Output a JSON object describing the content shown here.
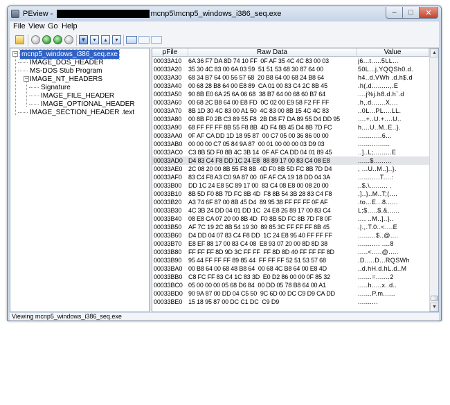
{
  "window": {
    "title_prefix": "PEview - ",
    "title_suffix": "mcnp5\\mcnp5_windows_i386_seq.exe",
    "minimize_glyph": "–",
    "maximize_glyph": "□",
    "close_glyph": "✕"
  },
  "menu": {
    "file": "File",
    "view": "View",
    "go": "Go",
    "help": "Help"
  },
  "toolbar_icons": [
    "open-folder-icon",
    "back-icon",
    "forward-icon",
    "up-icon",
    "down-icon",
    "save-icon",
    "byte-view-icon",
    "word-view-icon",
    "dword-view-icon",
    "address-icon",
    "column-view-icon",
    "row-view-icon"
  ],
  "tree": {
    "root": "mcnp5_windows_i386_seq.exe",
    "items": [
      "IMAGE_DOS_HEADER",
      "MS-DOS Stub Program",
      "IMAGE_NT_HEADERS",
      "Signature",
      "IMAGE_FILE_HEADER",
      "IMAGE_OPTIONAL_HEADER",
      "IMAGE_SECTION_HEADER .text"
    ]
  },
  "grid": {
    "headers": {
      "addr": "pFile",
      "raw": "Raw Data",
      "value": "Value"
    },
    "rows": [
      {
        "addr": "00033A10",
        "raw": "6A 36 F7 DA 8D 74 10 FF  0F AF 35 4C 4C 83 00 03",
        "value": "j6...t.....5LL..."
      },
      {
        "addr": "00033A20",
        "raw": "35 30 4C 83 00 6A 03 59  51 51 53 68 30 87 64 00",
        "value": "50L...j.YQQSh0.d."
      },
      {
        "addr": "00033A30",
        "raw": "68 34 B7 64 00 56 57 68  20 B8 64 00 68 24 B8 64",
        "value": "h4..d.VWh .d.h$.d"
      },
      {
        "addr": "00033A40",
        "raw": "00 68 28 B8 64 00 E8 89  CA 01 00 83 C4 2C 8B 45",
        "value": ".h(.d.........,.E"
      },
      {
        "addr": "00033A50",
        "raw": "90 8B E0 6A 25 6A 06 68  38 B7 64 00 68 60 B7 64",
        "value": "....j%j.h8.d.h`.d"
      },
      {
        "addr": "00033A60",
        "raw": "00 68 2C B8 64 00 E8 FD  0C 02 00 E9 58 F2 FF FF",
        "value": ".h,.d.......X...."
      },
      {
        "addr": "00033A70",
        "raw": "8B 1D 30 4C 83 00 A1 50  4C 83 00 8B 15 4C 4C 83",
        "value": "..0L...PL....LL."
      },
      {
        "addr": "00033A80",
        "raw": "00 8B F0 2B C3 89 55 F8  2B D8 F7 DA 89 55 D4 DD 95",
        "value": "....+..U.+....U.."
      },
      {
        "addr": "00033A90",
        "raw": "68 FF FF FF 8B 55 F8 8B  4D F4 8B 45 D4 8B 7D FC",
        "value": "h....U..M..E..}."
      },
      {
        "addr": "00033AA0",
        "raw": "0F AF CA DD 1D 18 95 87  00 C7 05 00 36 86 00 00",
        "value": "............6..."
      },
      {
        "addr": "00033AB0",
        "raw": "00 00 00 C7 05 84 9A 87  00 01 00 00 00 03 D9 03",
        "value": "................"
      },
      {
        "addr": "00033AC0",
        "raw": "C3 8B 5D F0 8B 4C 3B 14  0F AF CA DD 04 01 89 45",
        "value": "..]..L;.........E"
      },
      {
        "addr": "00033AD0",
        "raw": "D4 83 C4 F8 DD 1C 24 E8  88 89 17 00 83 C4 08 E8",
        "value": "......$........."
      },
      {
        "addr": "00033AE0",
        "raw": "2C 08 20 00 8B 55 F8 8B  4D F0 8B 5D FC 8B 7D D4",
        "value": ", ...U..M..]..}."
      },
      {
        "addr": "00033AF0",
        "raw": "83 C4 F8 A3 C0 9A 87 00  0F AF CA 19 18 DD 04 3A",
        "value": "...........T....:"
      },
      {
        "addr": "00033B00",
        "raw": "DD 1C 24 E8 5C 89 17 00  83 C4 08 E8 00 08 20 00",
        "value": "..$.\\......... ."
      },
      {
        "addr": "00033B10",
        "raw": "8B 5D F0 8B 7D FC 8B 4D  F8 8B 54 3B 28 83 C4 F8",
        "value": ".]..}..M..T;(...."
      },
      {
        "addr": "00033B20",
        "raw": "A3 74 6F 87 00 8B 45 D4  89 95 38 FF FF FF 0F AF",
        "value": ".to...E...8......"
      },
      {
        "addr": "00033B30",
        "raw": "4C 3B 24 DD 04 01 DD 1C  24 E8 26 89 17 00 83 C4",
        "value": "L;$.....$.&......"
      },
      {
        "addr": "00033B40",
        "raw": "08 E8 CA 07 20 00 8B 4D  F0 8B 5D FC 8B 7D F8 0F",
        "value": ".... ..M..]..}.."
      },
      {
        "addr": "00033B50",
        "raw": "AF 7C 19 2C 8B 54 19 30  89 85 3C FF FF FF 8B 45",
        "value": ".|.,.T.0..<....E"
      },
      {
        "addr": "00033B60",
        "raw": "D4 DD 04 07 83 C4 F8 DD  1C 24 E8 95 40 FF FF FF",
        "value": ".........$..@...."
      },
      {
        "addr": "00033B70",
        "raw": "E8 EF 88 17 00 83 C4 08  E8 93 07 20 00 8D 8D 38",
        "value": "........... ....8"
      },
      {
        "addr": "00033B80",
        "raw": "FF FF FF 8D 9D 3C FF FF  FF 8D 8D 40 FF FF FF 8D",
        "value": ".....<.....@....."
      },
      {
        "addr": "00033B90",
        "raw": "95 44 FF FF FF 89 85 44  FF FF FF 52 51 53 57 68",
        "value": ".D.....D...RQSWh"
      },
      {
        "addr": "00033BA0",
        "raw": "00 B8 64 00 68 48 B8 64  00 68 4C B8 64 00 E8 4D",
        "value": "..d.hH.d.hL.d..M"
      },
      {
        "addr": "00033BB0",
        "raw": "C8 FC FF 83 C4 1C 83 3D  E0 D2 86 00 00 0F 85 32",
        "value": ".......=.......2"
      },
      {
        "addr": "00033BC0",
        "raw": "05 00 00 00 05 68 D6 84  00 DD 05 78 B8 64 00 A1",
        "value": ".....h.....x..d.."
      },
      {
        "addr": "00033BD0",
        "raw": "90 9A 87 00 DD 04 C5 50  9C 6D 00 DC C9 D9 CA DD",
        "value": ".......P.m......"
      },
      {
        "addr": "00033BE0",
        "raw": "15 18 95 87 00 DC C1 DC  C9 D9",
        "value": ".........."
      }
    ]
  },
  "status": {
    "text": "Viewing mcnp5_windows_i386_seq.exe"
  }
}
